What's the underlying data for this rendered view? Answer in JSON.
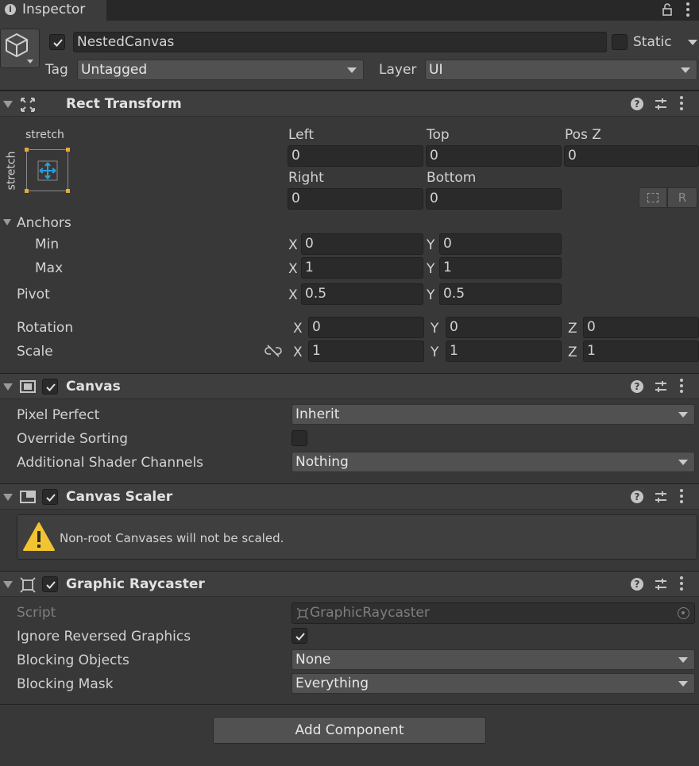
{
  "tab": {
    "title": "Inspector"
  },
  "object": {
    "name": "NestedCanvas",
    "active": true,
    "static_label": "Static",
    "tag_label": "Tag",
    "tag_value": "Untagged",
    "layer_label": "Layer",
    "layer_value": "UI"
  },
  "rect_transform": {
    "title": "Rect Transform",
    "anchor_preset_h": "stretch",
    "anchor_preset_v": "stretch",
    "left_label": "Left",
    "left": "0",
    "top_label": "Top",
    "top": "0",
    "posz_label": "Pos Z",
    "posz": "0",
    "right_label": "Right",
    "right": "0",
    "bottom_label": "Bottom",
    "bottom": "0",
    "raw_button": "R",
    "anchors_label": "Anchors",
    "min_label": "Min",
    "min_x": "0",
    "min_y": "0",
    "max_label": "Max",
    "max_x": "1",
    "max_y": "1",
    "pivot_label": "Pivot",
    "pivot_x": "0.5",
    "pivot_y": "0.5",
    "rotation_label": "Rotation",
    "rot_x": "0",
    "rot_y": "0",
    "rot_z": "0",
    "scale_label": "Scale",
    "scale_x": "1",
    "scale_y": "1",
    "scale_z": "1",
    "x": "X",
    "y": "Y",
    "z": "Z"
  },
  "canvas": {
    "title": "Canvas",
    "enabled": true,
    "pixel_perfect_label": "Pixel Perfect",
    "pixel_perfect": "Inherit",
    "override_sorting_label": "Override Sorting",
    "override_sorting": false,
    "shader_channels_label": "Additional Shader Channels",
    "shader_channels": "Nothing"
  },
  "canvas_scaler": {
    "title": "Canvas Scaler",
    "enabled": true,
    "warning": "Non-root Canvases will not be scaled."
  },
  "graphic_raycaster": {
    "title": "Graphic Raycaster",
    "enabled": true,
    "script_label": "Script",
    "script": "GraphicRaycaster",
    "ignore_reversed_label": "Ignore Reversed Graphics",
    "ignore_reversed": true,
    "blocking_objects_label": "Blocking Objects",
    "blocking_objects": "None",
    "blocking_mask_label": "Blocking Mask",
    "blocking_mask": "Everything"
  },
  "add_component": "Add Component",
  "colors": {
    "bg": "#383838",
    "header": "#3e3e3e",
    "field": "#2a2a2a",
    "dropdown": "#515151",
    "warning": "#f3c431",
    "anchor_accent": "#2a9fd6"
  }
}
